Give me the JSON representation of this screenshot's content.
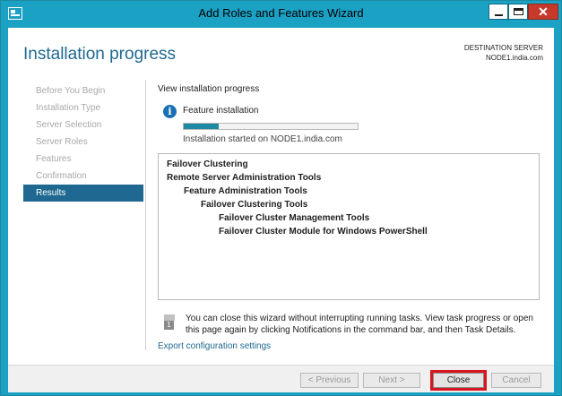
{
  "window": {
    "title": "Add Roles and Features Wizard",
    "close_glyph": "✕"
  },
  "header": {
    "page_title": "Installation progress",
    "destination_label": "DESTINATION SERVER",
    "destination_server": "NODE1.india.com"
  },
  "nav": {
    "items": [
      {
        "label": "Before You Begin",
        "active": false
      },
      {
        "label": "Installation Type",
        "active": false
      },
      {
        "label": "Server Selection",
        "active": false
      },
      {
        "label": "Server Roles",
        "active": false
      },
      {
        "label": "Features",
        "active": false
      },
      {
        "label": "Confirmation",
        "active": false
      },
      {
        "label": "Results",
        "active": true
      }
    ]
  },
  "main": {
    "view_label": "View installation progress",
    "info_glyph": "i",
    "feature_installation": "Feature installation",
    "progress_fraction": 0.2,
    "install_started": "Installation started on NODE1.india.com",
    "results": [
      {
        "text": "Failover Clustering",
        "level": 0
      },
      {
        "text": "Remote Server Administration Tools",
        "level": 0
      },
      {
        "text": "Feature Administration Tools",
        "level": 1
      },
      {
        "text": "Failover Clustering Tools",
        "level": 2
      },
      {
        "text": "Failover Cluster Management Tools",
        "level": 3
      },
      {
        "text": "Failover Cluster Module for Windows PowerShell",
        "level": 3
      }
    ],
    "note_glyph": "1",
    "note_text": "You can close this wizard without interrupting running tasks. View task progress or open this page again by clicking Notifications in the command bar, and then Task Details.",
    "export_link": "Export configuration settings"
  },
  "footer": {
    "previous_label": "< Previous",
    "next_label": "Next >",
    "close_label": "Close",
    "cancel_label": "Cancel"
  },
  "colors": {
    "titlebar": "#1ba1c4",
    "accent": "#1f6891",
    "progress": "#1c8aa0",
    "highlight_outline": "#d9141e"
  }
}
